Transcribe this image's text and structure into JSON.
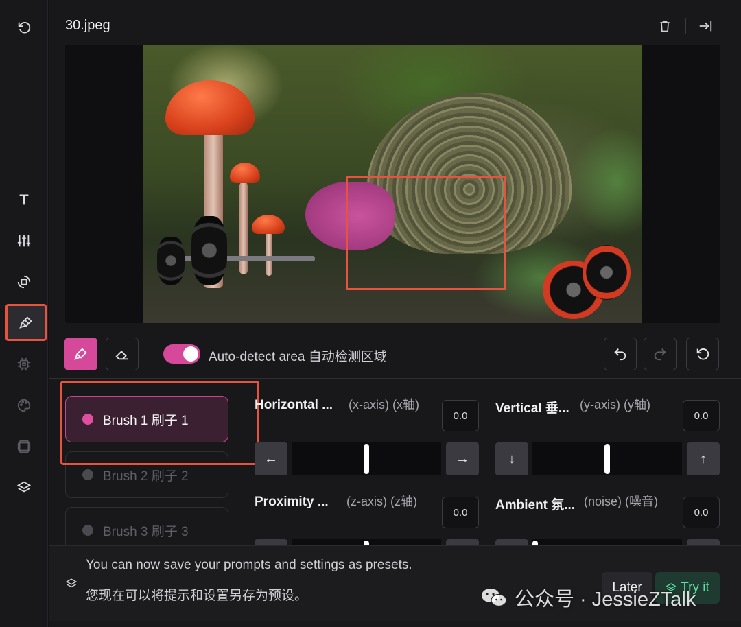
{
  "sidebar": {
    "items": [
      {
        "icon": "undo-icon",
        "state": "normal"
      },
      {
        "icon": "text-icon",
        "state": "normal"
      },
      {
        "icon": "sliders-icon",
        "state": "normal"
      },
      {
        "icon": "rotate-transform-icon",
        "state": "normal"
      },
      {
        "icon": "brush-icon",
        "state": "active"
      },
      {
        "icon": "chip-icon",
        "state": "dim"
      },
      {
        "icon": "palette-icon",
        "state": "dim"
      },
      {
        "icon": "frames-icon",
        "state": "dim"
      },
      {
        "icon": "layers-icon",
        "state": "normal"
      }
    ]
  },
  "header": {
    "file_name": "30.jpeg",
    "actions": [
      "trash-icon",
      "collapse-panel-icon"
    ]
  },
  "toolbar": {
    "auto_detect_label": "Auto-detect area 自动检测区域",
    "auto_detect_on": true
  },
  "brushes": [
    {
      "label": "Brush 1 刷子 1",
      "active": true
    },
    {
      "label": "Brush 2 刷子 2",
      "active": false
    },
    {
      "label": "Brush 3 刷子 3",
      "active": false
    }
  ],
  "controls": {
    "horizontal": {
      "title": "Horizontal ...",
      "sub": "(x-axis) (x轴)",
      "value": "0.0",
      "position": 0.5
    },
    "vertical": {
      "title": "Vertical 垂...",
      "sub": "(y-axis) (y轴)",
      "value": "0.0",
      "position": 0.5
    },
    "proximity": {
      "title": "Proximity ...",
      "sub": "(z-axis) (z轴)",
      "value": "0.0",
      "position": 0.5
    },
    "ambient": {
      "title": "Ambient 氛...",
      "sub": "(noise) (噪音)",
      "value": "0.0",
      "position": 0.0
    }
  },
  "banner": {
    "line1": "You can now save your prompts and settings as presets.",
    "line2": "您现在可以将提示和设置另存为预设。",
    "later_label": "Later",
    "try_label": "Try it"
  },
  "watermark": {
    "text": "公众号 · JessieZTalk"
  },
  "colors": {
    "accent_pink": "#d6489a",
    "highlight_red": "#e8533f",
    "try_green": "#5fe0a8"
  }
}
